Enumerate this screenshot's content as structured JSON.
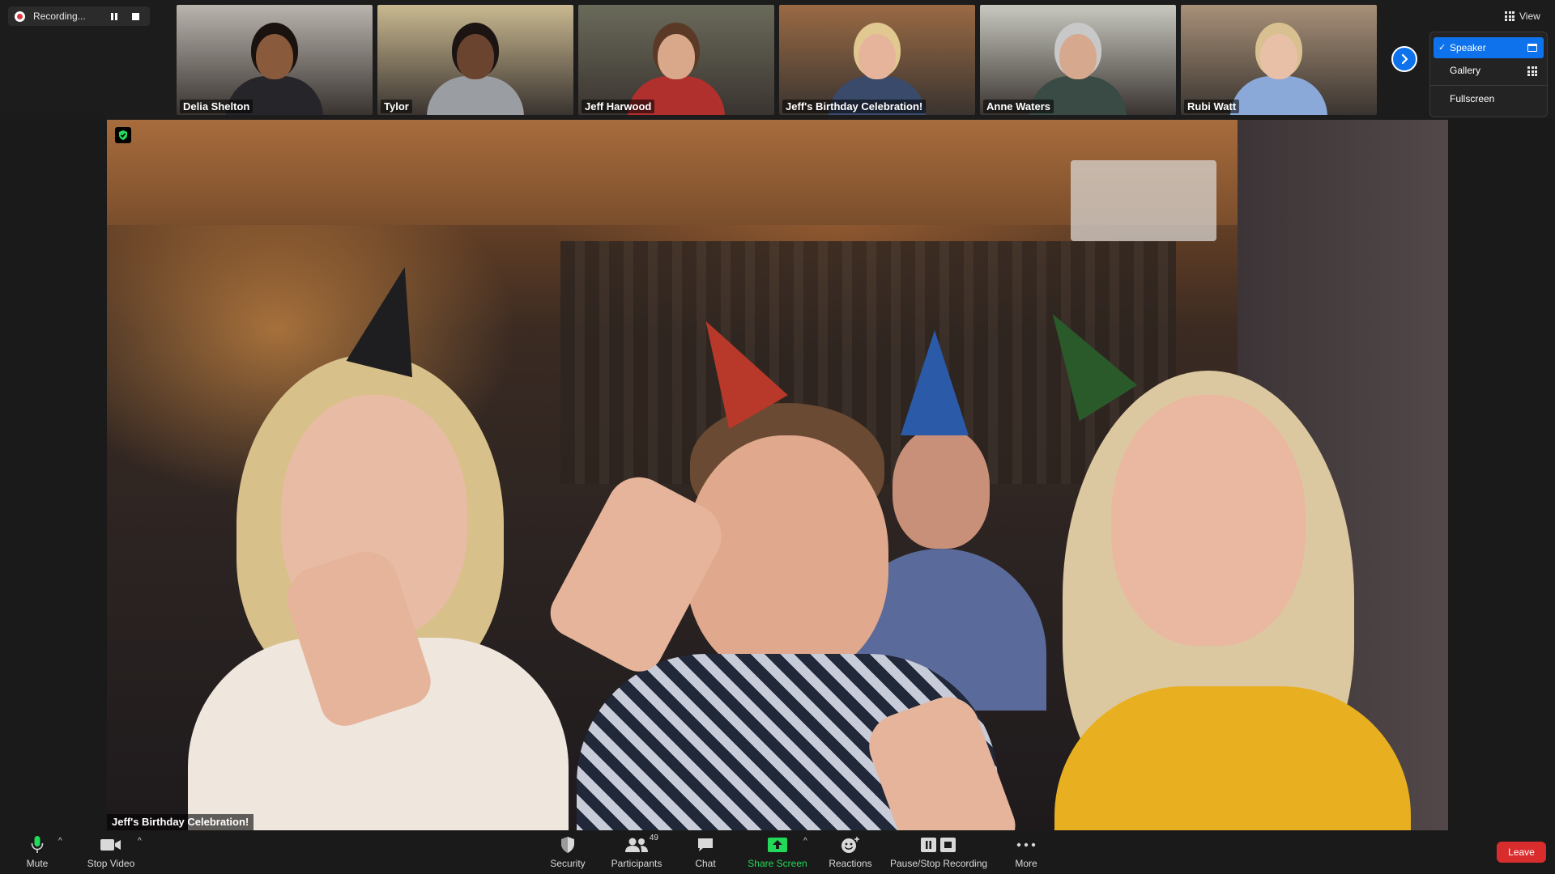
{
  "recording": {
    "status_label": "Recording...",
    "icons": [
      "record-dot-icon",
      "pause-icon",
      "stop-icon"
    ]
  },
  "participants_strip": [
    {
      "name": "Delia Shelton",
      "skin": "#8a5a3c",
      "hair": "#1a120e",
      "shirt": "#26262a",
      "bg": "#b9b4ae"
    },
    {
      "name": "Tylor",
      "skin": "#6b4430",
      "hair": "#1b1412",
      "shirt": "#9a9ea2",
      "bg": "#c9b890"
    },
    {
      "name": "Jeff Harwood",
      "skin": "#d9a88a",
      "hair": "#5a3a26",
      "shirt": "#b0302e",
      "bg": "#6a6a5a"
    },
    {
      "name": "Jeff's Birthday Celebration!",
      "skin": "#e5b49a",
      "hair": "#e0c890",
      "shirt": "#3a4a6a",
      "bg": "#9a6a44"
    },
    {
      "name": "Anne Waters",
      "skin": "#d6a88e",
      "hair": "#c8c8c8",
      "shirt": "#3a4a44",
      "bg": "#c8c8c0"
    },
    {
      "name": "Rubi Watt",
      "skin": "#e8c0a8",
      "hair": "#d8c090",
      "shirt": "#8aa8d8",
      "bg": "#a89078"
    }
  ],
  "view_button": {
    "label": "View"
  },
  "view_menu": {
    "items": [
      {
        "label": "Speaker",
        "selected": true
      },
      {
        "label": "Gallery",
        "selected": false
      },
      {
        "label": "Fullscreen",
        "selected": false
      }
    ]
  },
  "main_video": {
    "label": "Jeff's Birthday Celebration!"
  },
  "toolbar": {
    "mute": "Mute",
    "stop_video": "Stop Video",
    "security": "Security",
    "participants": "Participants",
    "participants_count": "49",
    "chat": "Chat",
    "share_screen": "Share Screen",
    "reactions": "Reactions",
    "pause_stop_recording": "Pause/Stop Recording",
    "more": "More",
    "leave": "Leave",
    "caret_glyph": "^"
  },
  "colors": {
    "accent_blue": "#0e72ed",
    "share_green": "#23d959",
    "leave_red": "#d92d2d",
    "record_red": "#e0363f",
    "background": "#1a1a1a"
  }
}
